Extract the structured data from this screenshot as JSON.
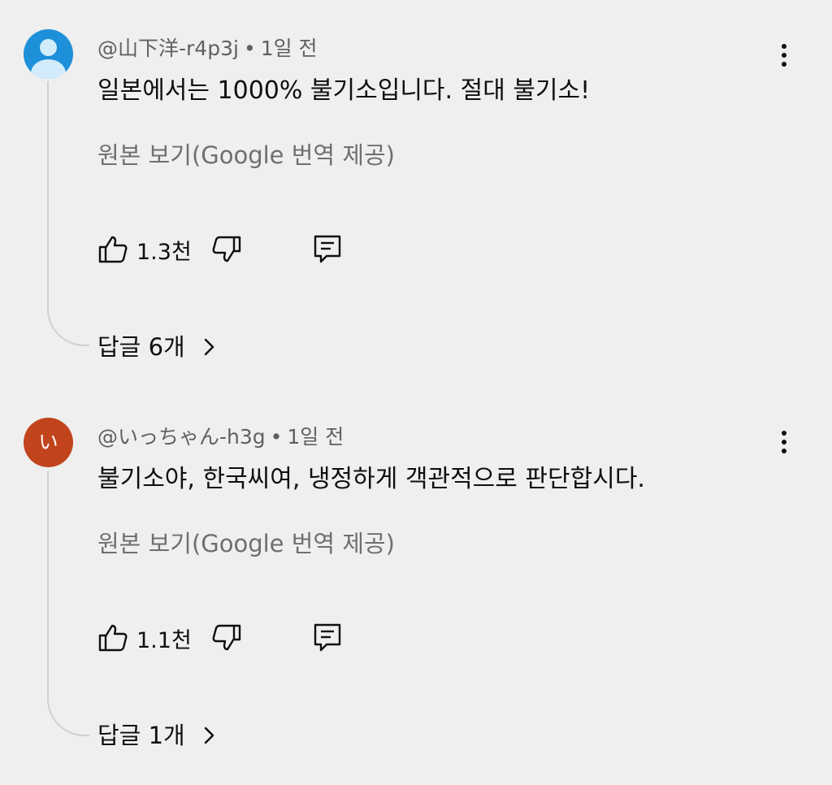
{
  "comments": [
    {
      "author": "@山下洋-r4p3j",
      "separator": "•",
      "time": "1일 전",
      "avatar": {
        "type": "default-person",
        "color": "#1e8fd9"
      },
      "text": "일본에서는 1000% 불기소입니다. 절대 불기소!",
      "translate_label": "원본 보기(Google 번역 제공)",
      "likes": "1.3천",
      "replies_label": "답글 6개"
    },
    {
      "author": "@いっちゃん-h3g",
      "separator": "•",
      "time": "1일 전",
      "avatar": {
        "type": "letter",
        "letter": "い",
        "color": "#c1441d"
      },
      "text": "불기소야, 한국씨여, 냉정하게 객관적으로 판단합시다.",
      "translate_label": "원본 보기(Google 번역 제공)",
      "likes": "1.1천",
      "replies_label": "답글 1개"
    }
  ],
  "icons": {
    "like": "thumbs-up-icon",
    "dislike": "thumbs-down-icon",
    "reply": "reply-comment-icon",
    "more": "more-vertical-icon",
    "expand": "chevron-right-icon"
  }
}
